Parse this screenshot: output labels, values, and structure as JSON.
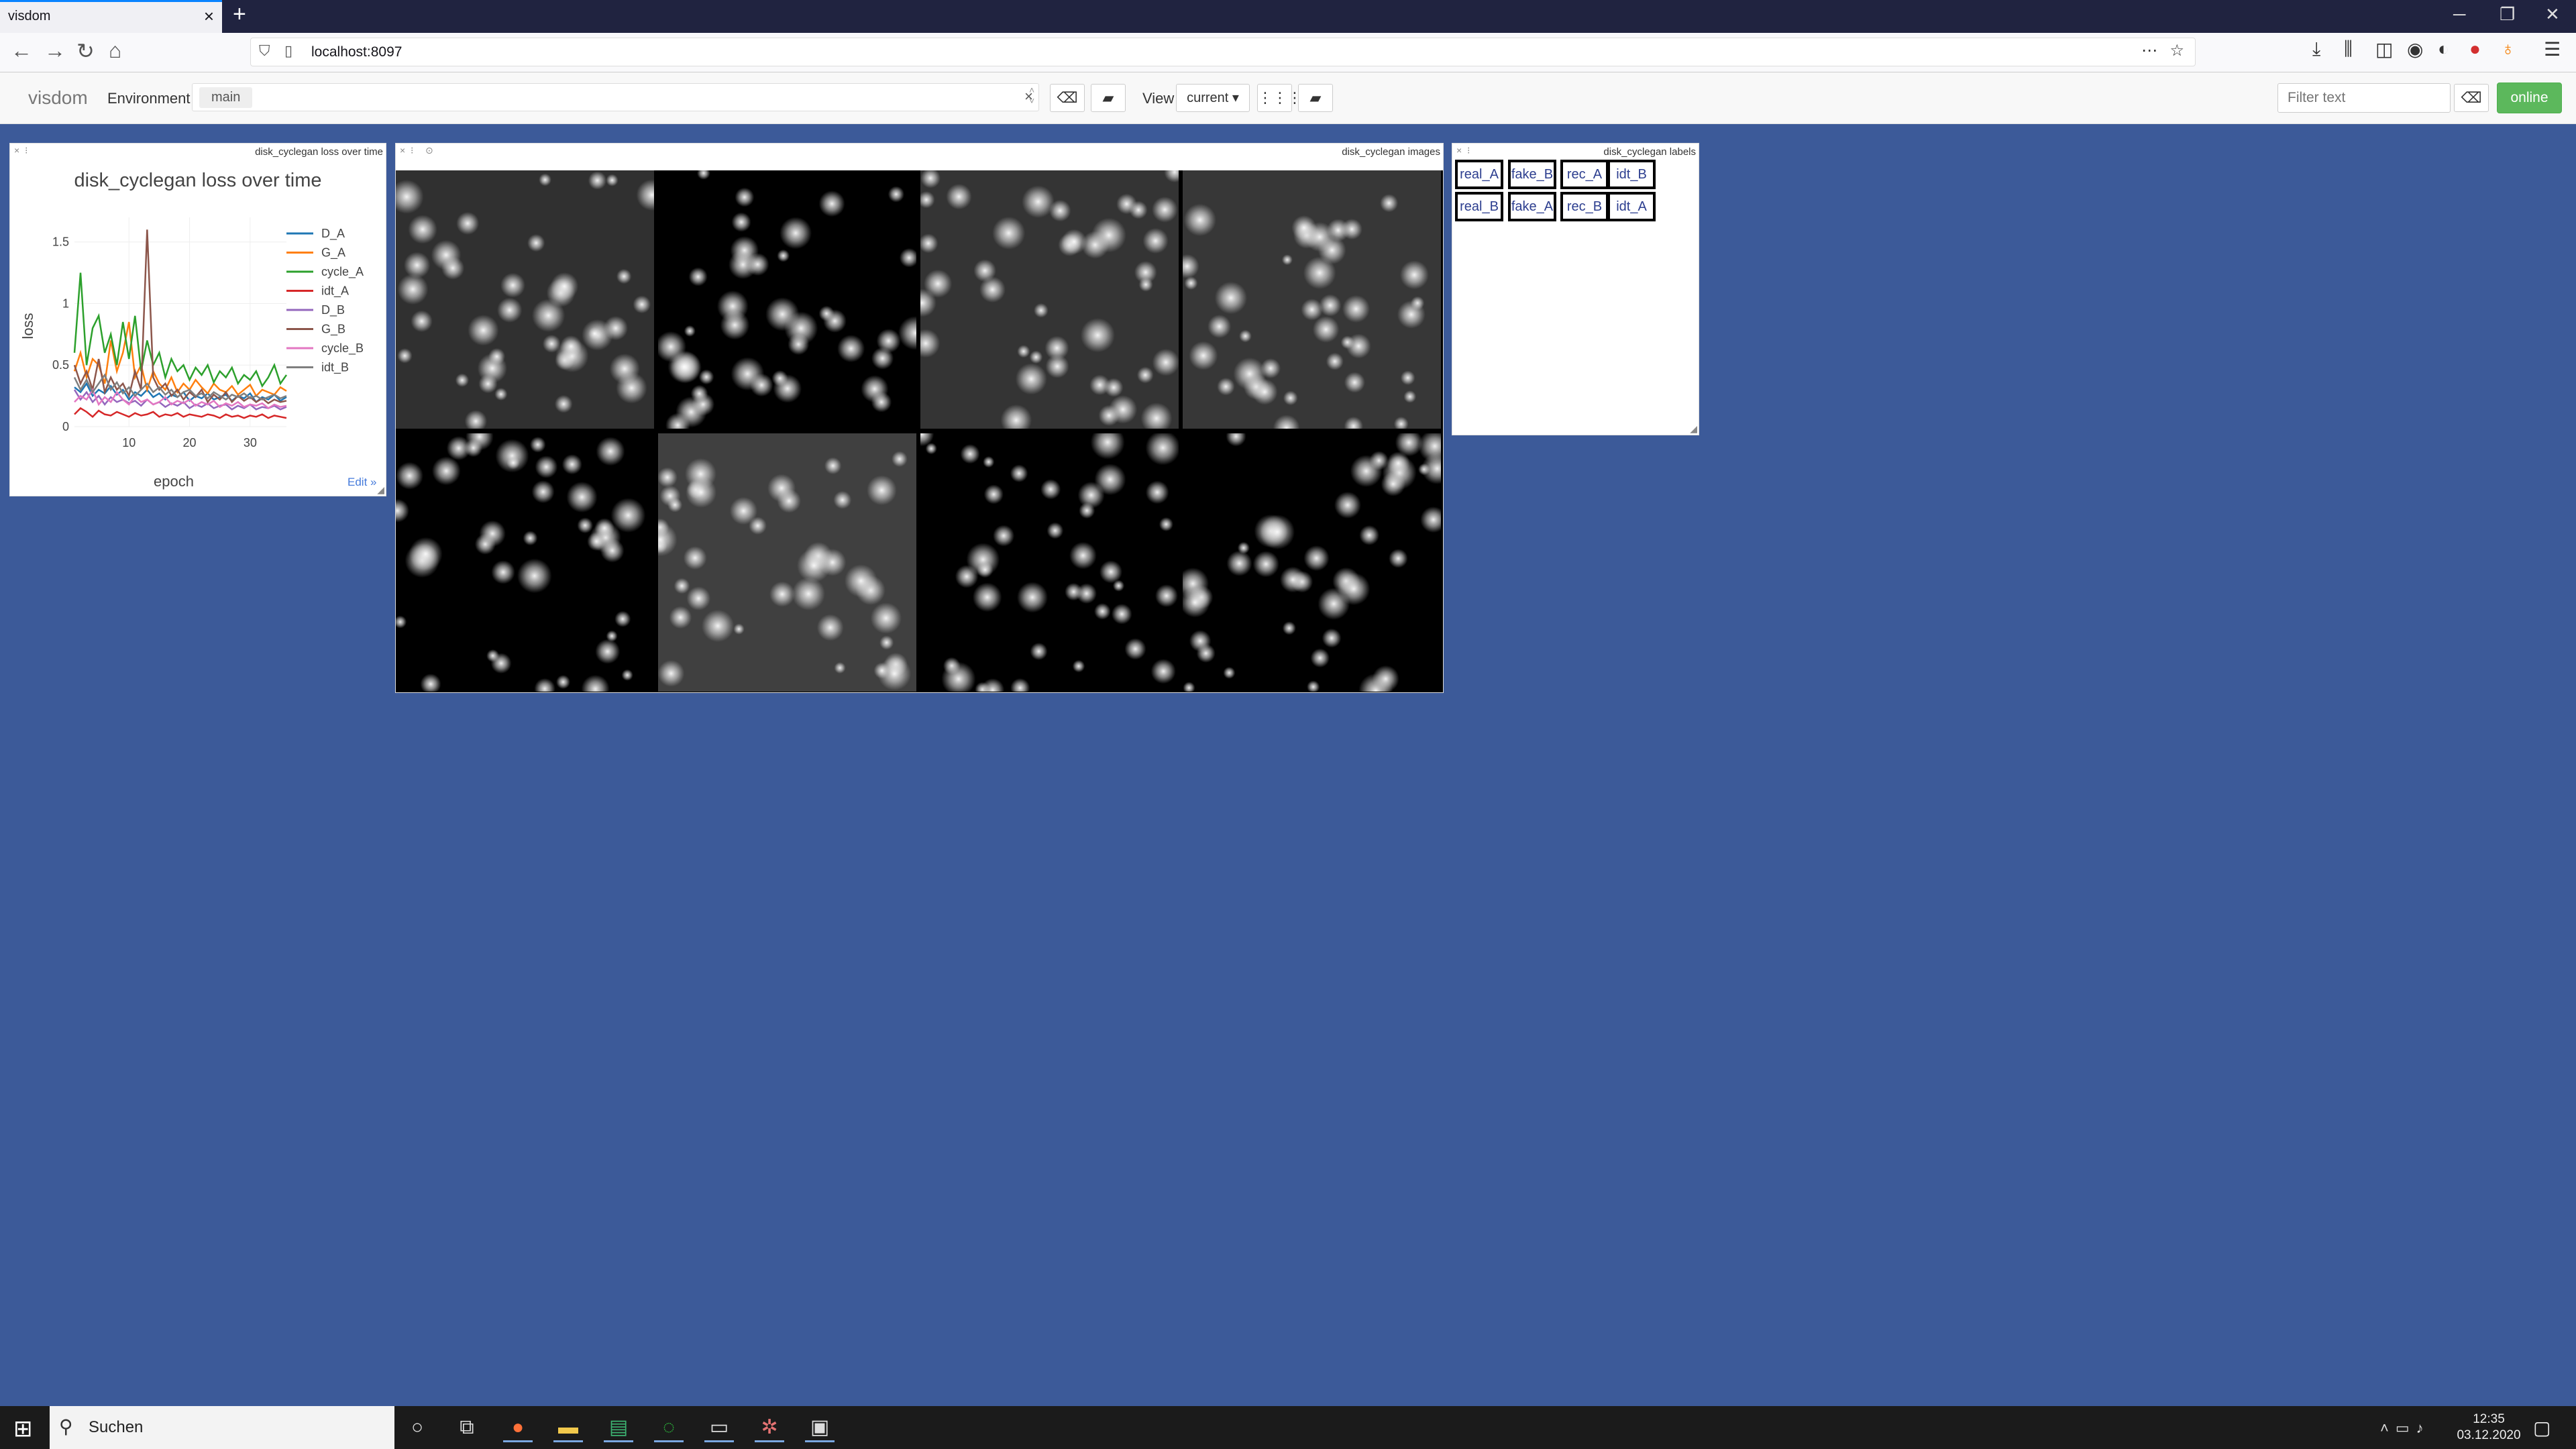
{
  "browser": {
    "tab_title": "visdom",
    "tab_close": "×",
    "new_tab": "+",
    "url": "localhost:8097",
    "window_controls": [
      "─",
      "❐",
      "✕"
    ]
  },
  "visdom": {
    "brand": "visdom",
    "environment_label": "Environment",
    "environment_chip": "main",
    "view_label": "View",
    "view_value": "current ▾",
    "filter_placeholder": "Filter text",
    "online_label": "online"
  },
  "panes": {
    "plot": {
      "pane_title": "disk_cyclegan loss over time",
      "edit_label": "Edit »"
    },
    "images": {
      "pane_title": "disk_cyclegan images",
      "tiles": [
        {
          "bg": 48,
          "seed": 11
        },
        {
          "bg": 0,
          "seed": 23
        },
        {
          "bg": 52,
          "seed": 37
        },
        {
          "bg": 55,
          "seed": 41
        },
        {
          "bg": 0,
          "seed": 53
        },
        {
          "bg": 64,
          "seed": 67
        },
        {
          "bg": 0,
          "seed": 71
        },
        {
          "bg": 0,
          "seed": 89
        }
      ]
    },
    "labels": {
      "pane_title": "disk_cyclegan labels",
      "rows": [
        [
          "real_A",
          "fake_B",
          "rec_A",
          "idt_B"
        ],
        [
          "real_B",
          "fake_A",
          "rec_B",
          "idt_A"
        ]
      ]
    }
  },
  "chart_data": {
    "type": "line",
    "title": "disk_cyclegan loss over time",
    "xlabel": "epoch",
    "ylabel": "loss",
    "xlim": [
      1,
      36
    ],
    "ylim": [
      0,
      1.7
    ],
    "xticks": [
      10,
      20,
      30
    ],
    "yticks": [
      0,
      0.5,
      1,
      1.5
    ],
    "ytick_labels": [
      "0",
      "0.5",
      "1",
      "1.5"
    ],
    "grid": true,
    "legend_position": "right",
    "x": [
      1,
      2,
      3,
      4,
      5,
      6,
      7,
      8,
      9,
      10,
      11,
      12,
      13,
      14,
      15,
      16,
      17,
      18,
      19,
      20,
      21,
      22,
      23,
      24,
      25,
      26,
      27,
      28,
      29,
      30,
      31,
      32,
      33,
      34,
      35,
      36
    ],
    "series": [
      {
        "name": "D_A",
        "color": "#1f77b4",
        "values": [
          0.32,
          0.28,
          0.35,
          0.25,
          0.3,
          0.27,
          0.33,
          0.26,
          0.3,
          0.22,
          0.28,
          0.25,
          0.3,
          0.24,
          0.27,
          0.22,
          0.26,
          0.24,
          0.28,
          0.21,
          0.25,
          0.23,
          0.27,
          0.22,
          0.24,
          0.26,
          0.21,
          0.25,
          0.23,
          0.27,
          0.2,
          0.24,
          0.22,
          0.26,
          0.21,
          0.24
        ]
      },
      {
        "name": "G_A",
        "color": "#ff7f0e",
        "values": [
          0.45,
          0.6,
          0.4,
          0.55,
          0.5,
          0.35,
          0.7,
          0.45,
          0.6,
          0.85,
          0.4,
          0.5,
          0.3,
          0.45,
          0.35,
          0.3,
          0.4,
          0.28,
          0.35,
          0.3,
          0.38,
          0.32,
          0.27,
          0.35,
          0.3,
          0.28,
          0.33,
          0.26,
          0.3,
          0.34,
          0.25,
          0.3,
          0.28,
          0.26,
          0.32,
          0.29
        ]
      },
      {
        "name": "cycle_A",
        "color": "#2ca02c",
        "values": [
          0.6,
          1.25,
          0.5,
          0.8,
          0.9,
          0.6,
          0.75,
          0.5,
          0.85,
          0.55,
          0.9,
          0.45,
          0.7,
          0.5,
          0.6,
          0.4,
          0.55,
          0.45,
          0.5,
          0.38,
          0.48,
          0.42,
          0.5,
          0.36,
          0.45,
          0.4,
          0.48,
          0.35,
          0.42,
          0.38,
          0.45,
          0.33,
          0.4,
          0.5,
          0.35,
          0.42
        ]
      },
      {
        "name": "idt_A",
        "color": "#d62728",
        "values": [
          0.1,
          0.15,
          0.12,
          0.08,
          0.13,
          0.1,
          0.09,
          0.12,
          0.1,
          0.08,
          0.11,
          0.09,
          0.1,
          0.12,
          0.08,
          0.1,
          0.09,
          0.11,
          0.08,
          0.1,
          0.09,
          0.08,
          0.1,
          0.09,
          0.07,
          0.1,
          0.08,
          0.09,
          0.07,
          0.09,
          0.08,
          0.1,
          0.07,
          0.09,
          0.08,
          0.07
        ]
      },
      {
        "name": "D_B",
        "color": "#9467bd",
        "values": [
          0.3,
          0.22,
          0.28,
          0.2,
          0.25,
          0.18,
          0.24,
          0.2,
          0.22,
          0.19,
          0.21,
          0.17,
          0.22,
          0.18,
          0.2,
          0.16,
          0.19,
          0.17,
          0.2,
          0.15,
          0.18,
          0.16,
          0.19,
          0.15,
          0.17,
          0.18,
          0.14,
          0.17,
          0.15,
          0.18,
          0.14,
          0.16,
          0.15,
          0.17,
          0.14,
          0.16
        ]
      },
      {
        "name": "G_B",
        "color": "#8c564b",
        "values": [
          0.5,
          0.35,
          0.45,
          0.3,
          0.55,
          0.28,
          0.4,
          0.3,
          0.35,
          0.25,
          0.45,
          0.3,
          1.6,
          0.4,
          0.3,
          0.35,
          0.25,
          0.3,
          0.22,
          0.28,
          0.24,
          0.3,
          0.2,
          0.26,
          0.22,
          0.28,
          0.2,
          0.25,
          0.21,
          0.24,
          0.2,
          0.23,
          0.19,
          0.22,
          0.2,
          0.21
        ]
      },
      {
        "name": "cycle_B",
        "color": "#e377c2",
        "values": [
          0.2,
          0.25,
          0.22,
          0.3,
          0.18,
          0.24,
          0.2,
          0.28,
          0.22,
          0.18,
          0.25,
          0.2,
          0.22,
          0.18,
          0.2,
          0.24,
          0.18,
          0.21,
          0.19,
          0.22,
          0.17,
          0.2,
          0.18,
          0.21,
          0.16,
          0.19,
          0.17,
          0.2,
          0.16,
          0.18,
          0.17,
          0.19,
          0.15,
          0.18,
          0.16,
          0.17
        ]
      },
      {
        "name": "idt_B",
        "color": "#7f7f7f",
        "values": [
          0.4,
          0.3,
          0.38,
          0.28,
          0.35,
          0.42,
          0.3,
          0.36,
          0.27,
          0.32,
          0.25,
          0.3,
          0.35,
          0.28,
          0.32,
          0.26,
          0.3,
          0.24,
          0.28,
          0.3,
          0.25,
          0.27,
          0.23,
          0.28,
          0.25,
          0.22,
          0.26,
          0.24,
          0.27,
          0.23,
          0.25,
          0.22,
          0.24,
          0.26,
          0.23,
          0.25
        ]
      }
    ]
  },
  "taskbar": {
    "search_placeholder": "Suchen",
    "time": "12:35",
    "date": "03.12.2020"
  }
}
